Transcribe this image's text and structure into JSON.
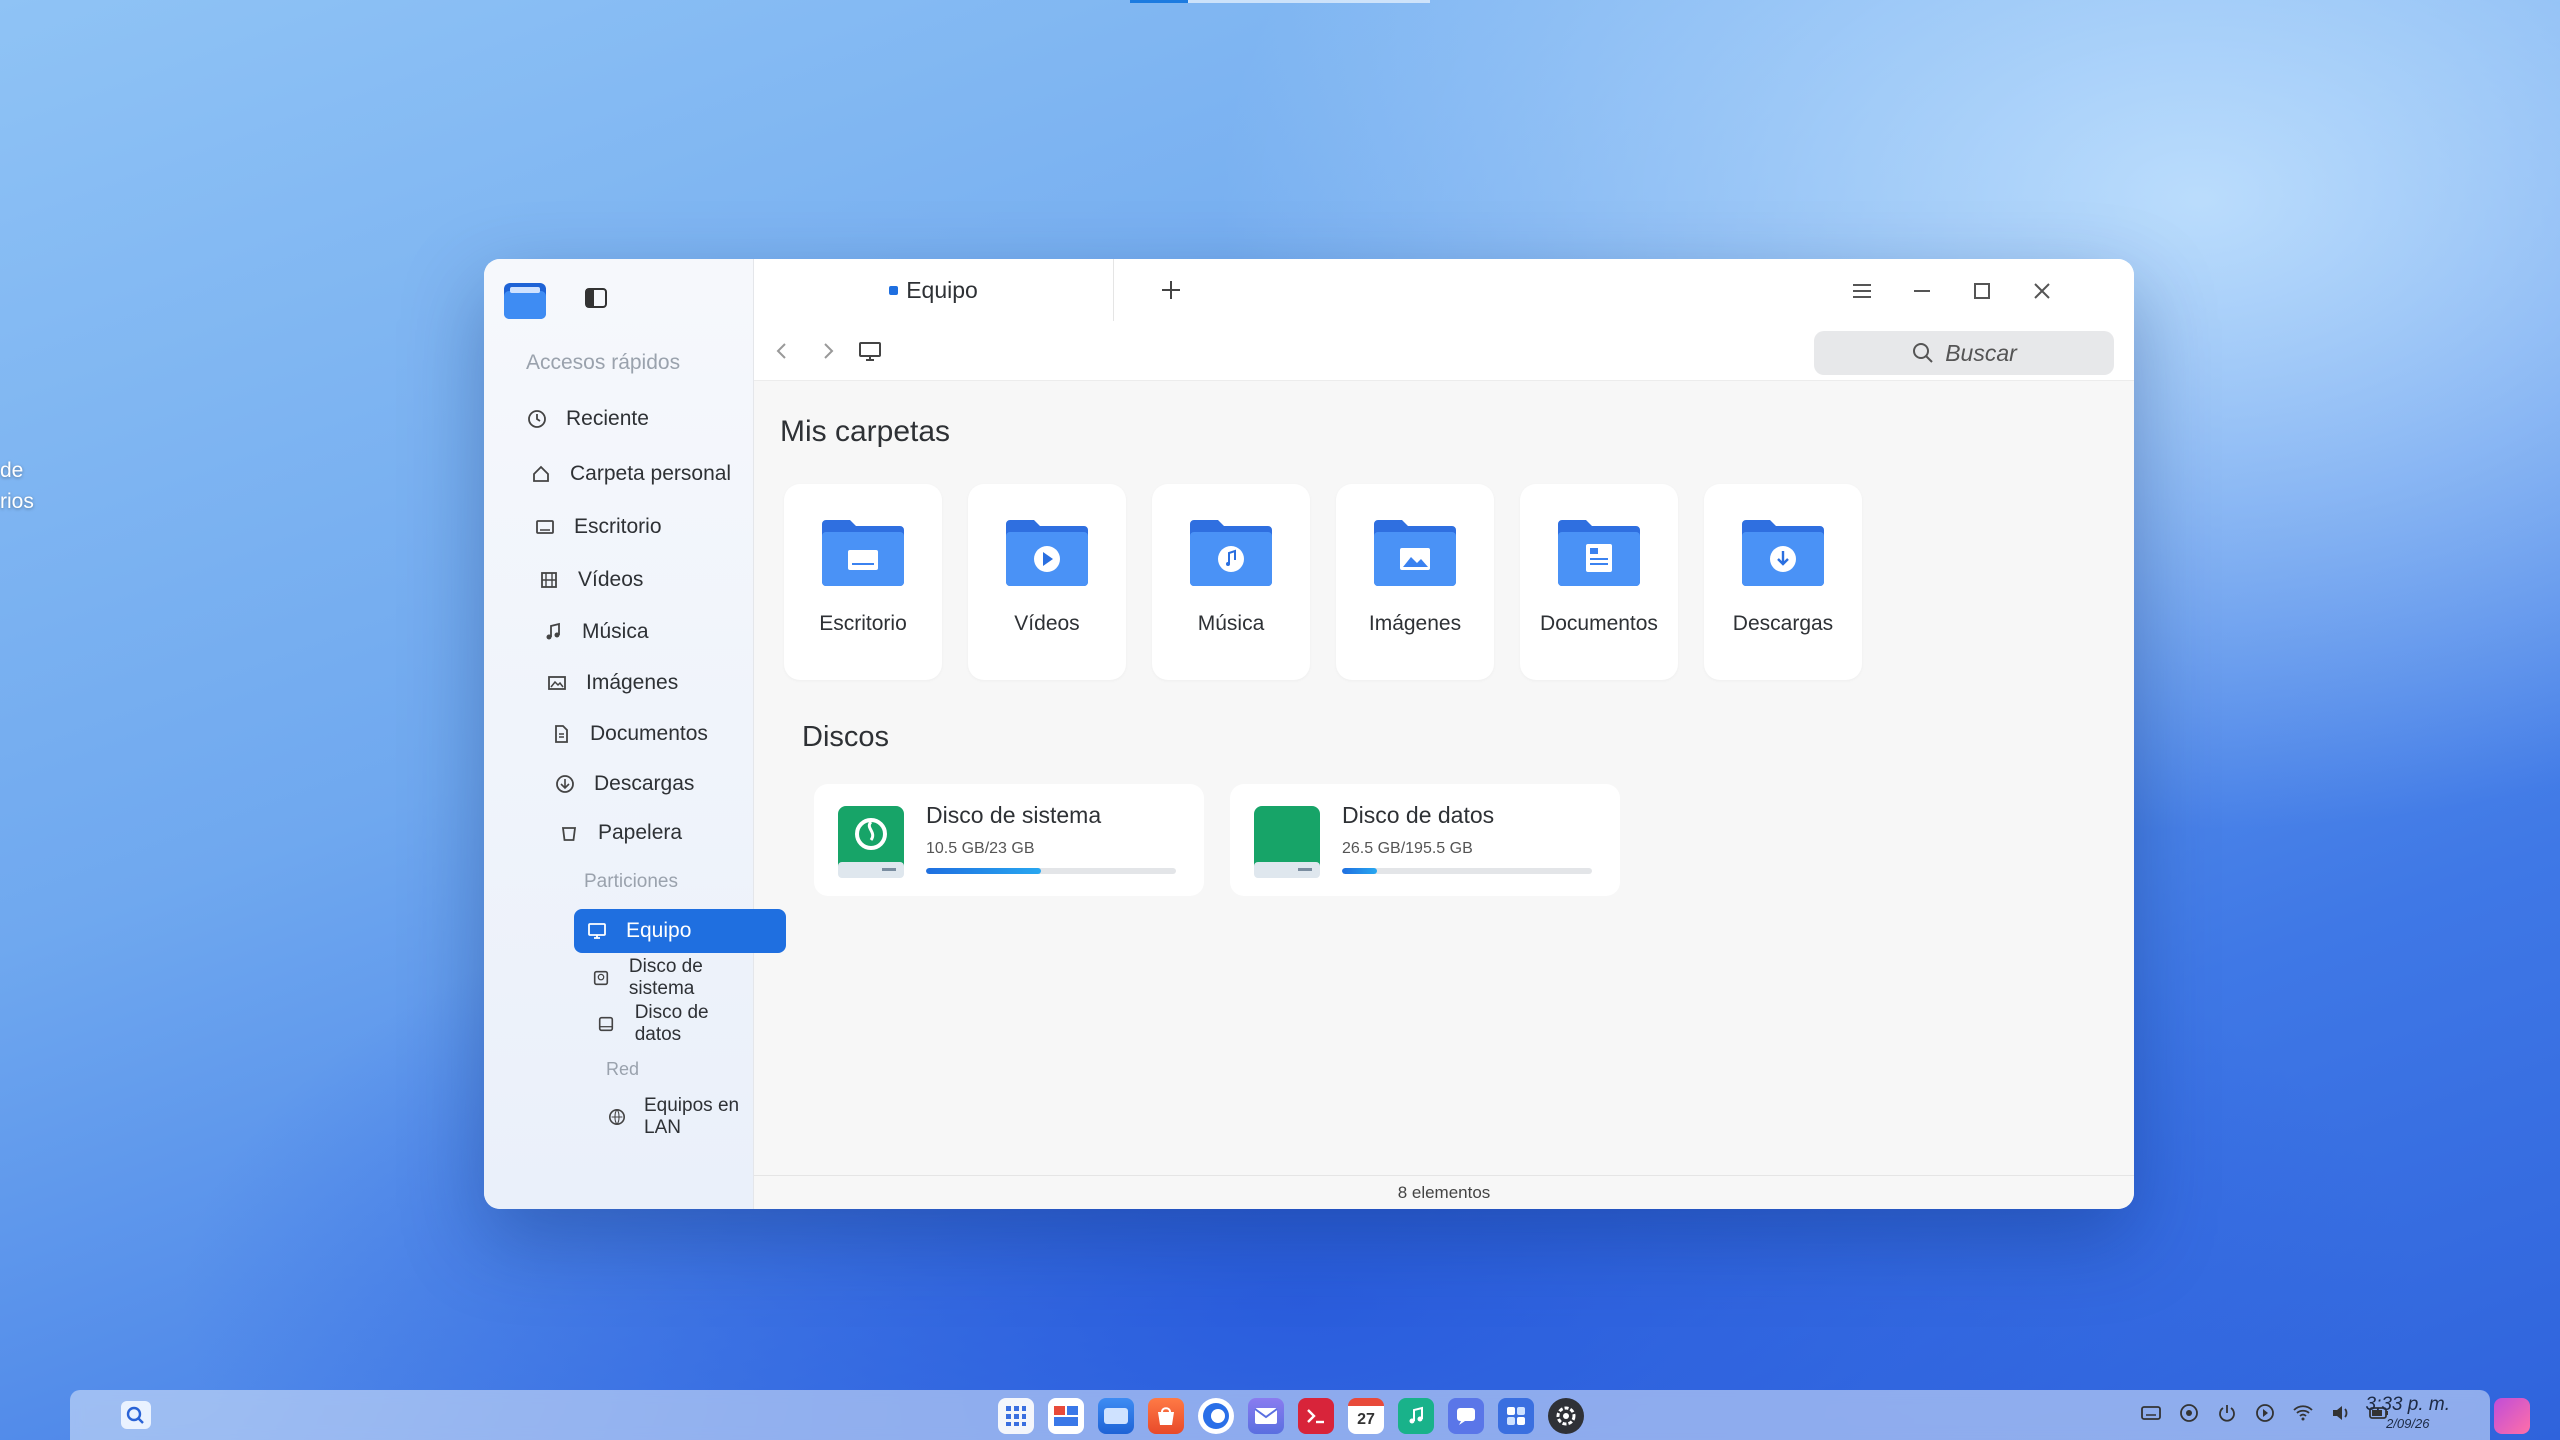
{
  "desktop": {
    "label_lines": [
      "de",
      "rios"
    ]
  },
  "window": {
    "sidebar": {
      "quick_access_title": "Accesos rápidos",
      "items": [
        {
          "label": "Reciente",
          "icon": "clock-icon"
        },
        {
          "label": "Carpeta personal",
          "icon": "home-icon"
        },
        {
          "label": "Escritorio",
          "icon": "desktop-icon"
        },
        {
          "label": "Vídeos",
          "icon": "film-icon"
        },
        {
          "label": "Música",
          "icon": "music-note-icon"
        },
        {
          "label": "Imágenes",
          "icon": "image-icon"
        },
        {
          "label": "Documentos",
          "icon": "document-icon"
        },
        {
          "label": "Descargas",
          "icon": "download-icon"
        },
        {
          "label": "Papelera",
          "icon": "trash-icon"
        }
      ],
      "partitions_title": "Particiones",
      "computer": {
        "label": "Equipo",
        "icon": "computer-icon"
      },
      "partitions": [
        {
          "label": "Disco de sistema",
          "icon": "system-disk-icon"
        },
        {
          "label": "Disco de datos",
          "icon": "data-disk-icon"
        }
      ],
      "network_title": "Red",
      "network": [
        {
          "label": "Equipos en LAN",
          "icon": "network-icon"
        }
      ]
    },
    "tab": {
      "label": "Equipo"
    },
    "search": {
      "placeholder": "Buscar"
    },
    "folders_heading": "Mis carpetas",
    "folders": [
      {
        "label": "Escritorio",
        "icon": "desktop-folder-icon"
      },
      {
        "label": "Vídeos",
        "icon": "videos-folder-icon"
      },
      {
        "label": "Música",
        "icon": "music-folder-icon"
      },
      {
        "label": "Imágenes",
        "icon": "images-folder-icon"
      },
      {
        "label": "Documentos",
        "icon": "documents-folder-icon"
      },
      {
        "label": "Descargas",
        "icon": "downloads-folder-icon"
      }
    ],
    "disks_heading": "Discos",
    "disks": [
      {
        "name": "Disco de sistema",
        "usage": "10.5 GB/23 GB",
        "fraction": 0.46,
        "color": "#1aa36b"
      },
      {
        "name": "Disco de datos",
        "usage": "26.5 GB/195.5 GB",
        "fraction": 0.14,
        "color": "#1aa36b"
      }
    ],
    "status": "8 elementos"
  },
  "taskbar": {
    "clock_time": "3:33 p. m.",
    "clock_date": "2/09/26",
    "calendar_day": "27",
    "dock_apps": [
      "launcher",
      "multitasking",
      "file-manager",
      "app-store",
      "browser",
      "mail",
      "terminal",
      "calendar",
      "music",
      "chat",
      "control-panel",
      "settings"
    ]
  },
  "colors": {
    "accent": "#1f6fe0",
    "folder_blue": "#3b82f0"
  }
}
